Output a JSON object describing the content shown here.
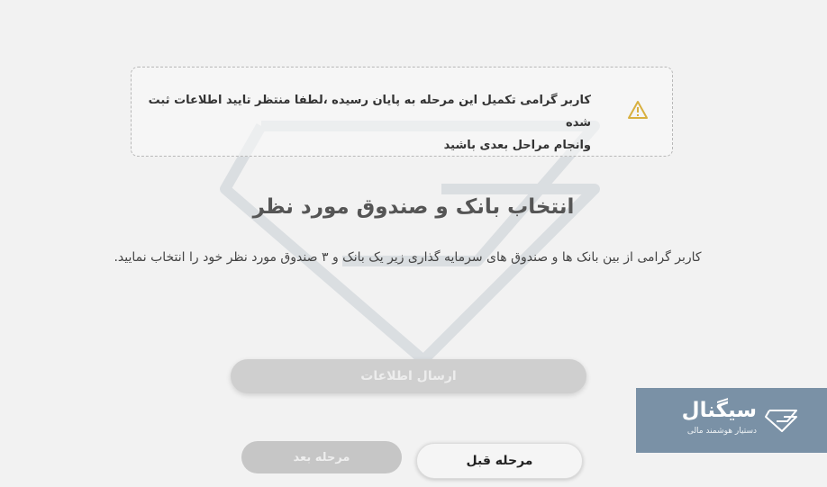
{
  "alert": {
    "line1": "کاربر گرامی تکمیل این مرحله به پایان رسیده ،لطفا منتظر تایید اطلاعات ثبت شده",
    "line2": "وانجام مراحل بعدی باشید"
  },
  "title": "انتخاب بانک و صندوق مورد نظر",
  "description": "کاربر گرامی از بین بانک ها و صندوق های سرمایه گذاری زیر یک بانک و ۳ صندوق مورد نظر خود را انتخاب نمایید.",
  "buttons": {
    "submit": "ارسال اطلاعات",
    "next": "مرحله بعد",
    "prev": "مرحله قبل"
  },
  "brand": {
    "name": "سیگنال",
    "subtitle": "دستیار هوشمند مالی"
  },
  "colors": {
    "background": "#f2f2f2",
    "brand": "#7a91a6",
    "warning": "#d8b040",
    "watermark": "#8a9aaa"
  }
}
